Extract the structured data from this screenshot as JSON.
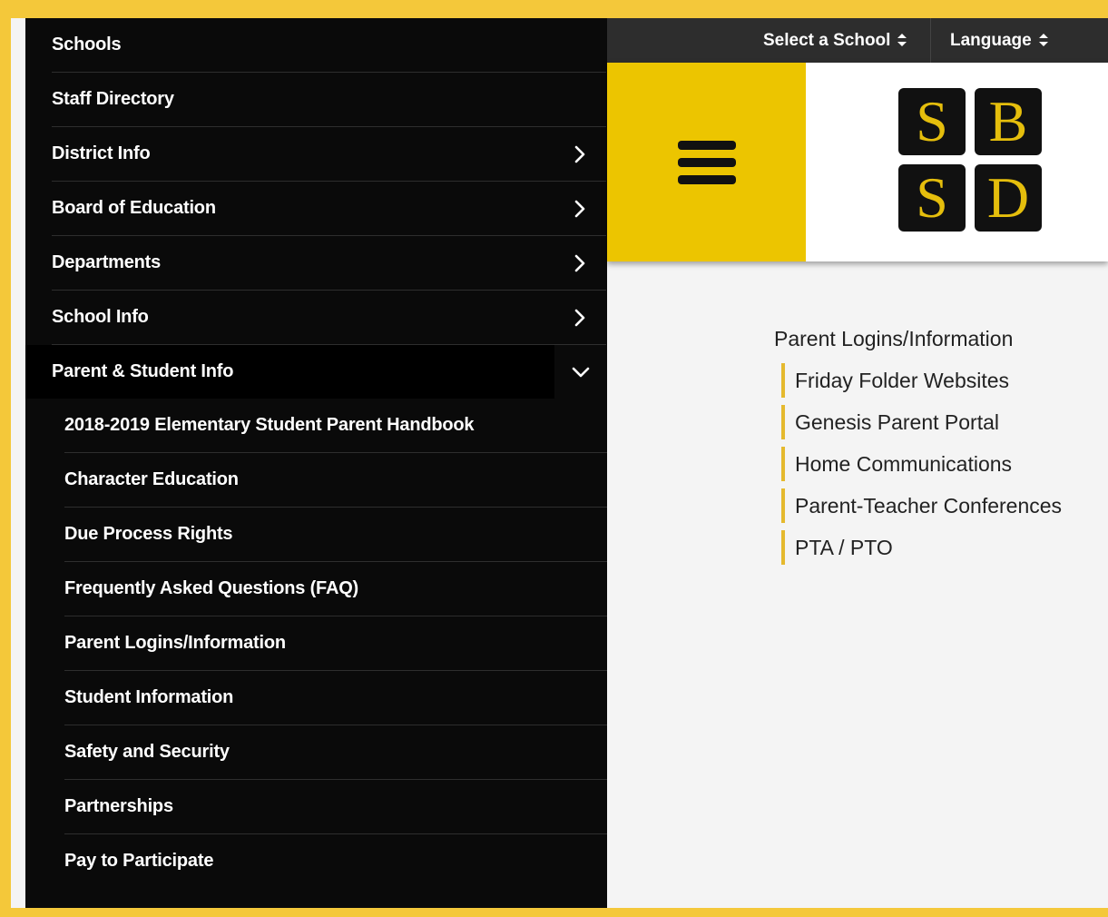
{
  "top_bar": {
    "select_school": "Select a School",
    "language": "Language"
  },
  "logo": {
    "letters": [
      "S",
      "B",
      "S",
      "D"
    ]
  },
  "nav": {
    "items": [
      {
        "label": "Schools",
        "has_arrow": false
      },
      {
        "label": "Staff Directory",
        "has_arrow": false
      },
      {
        "label": "District Info",
        "has_arrow": true
      },
      {
        "label": "Board of Education",
        "has_arrow": true
      },
      {
        "label": "Departments",
        "has_arrow": true
      },
      {
        "label": "School Info",
        "has_arrow": true
      }
    ],
    "expanded": {
      "label": "Parent & Student Info",
      "subitems": [
        "2018-2019 Elementary Student Parent Handbook",
        "Character Education",
        "Due Process Rights",
        "Frequently Asked Questions (FAQ)",
        "Parent Logins/Information",
        "Student Information",
        "Safety and Security",
        "Partnerships",
        "Pay to Participate"
      ]
    }
  },
  "content": {
    "title": "Parent Logins/Information",
    "links": [
      "Friday Folder Websites",
      "Genesis Parent Portal",
      "Home Communications",
      "Parent-Teacher Conferences",
      "PTA / PTO"
    ]
  },
  "colors": {
    "accent": "#ecc500",
    "border": "#f4c83a",
    "sidebar": "#0a0a0a"
  },
  "icons": {
    "menu": "hamburger-icon",
    "arrow": "chevron-right-icon",
    "expanded": "chevron-down-icon",
    "select": "sort-arrows-icon"
  }
}
